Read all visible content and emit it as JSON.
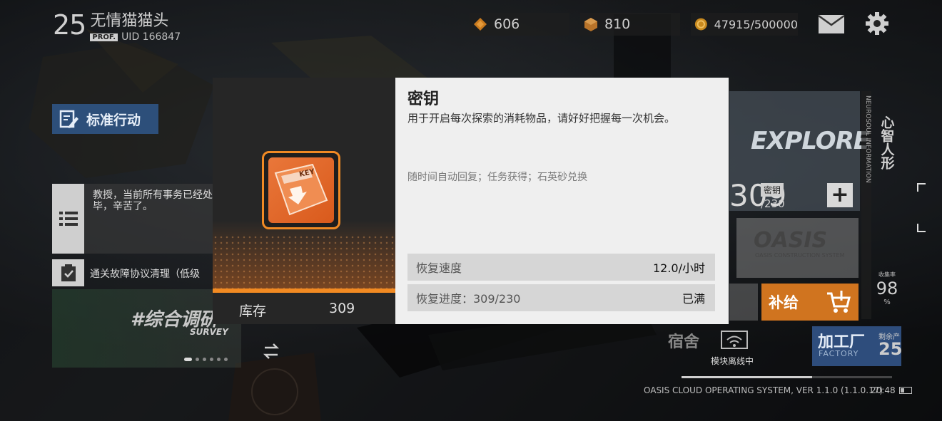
{
  "player": {
    "level": "25",
    "name": "无情猫猫头",
    "badge": "PROF.",
    "uid": "UID 166847"
  },
  "resources": [
    {
      "icon": "gem-icon",
      "value": "606"
    },
    {
      "icon": "crate-icon",
      "value": "810"
    },
    {
      "icon": "coin-icon",
      "value": "47915/500000"
    }
  ],
  "left": {
    "standard_action": "标准行动",
    "notice": "教授，当前所有事务已经处理完毕，辛苦了。",
    "task": "通关故障协议清理（低级",
    "survey_title": "#综合调研",
    "survey_sub": "SURVEY"
  },
  "right": {
    "explore": "EXPLORE",
    "key_big": "309",
    "key_tag": "密钥",
    "key_max": "/230",
    "plus": "+",
    "oasis": "OASIS",
    "oasis_sub": "OASIS CONSTRUCTION SYSTEM",
    "supply": "补给",
    "vertical_info": "NEUROSOUL INFORMATION",
    "mind": "心智人形",
    "rate_label": "收集率",
    "rate_value": "98",
    "rate_unit": "%",
    "dorm": "宿舍",
    "dorm_status": "模块离线中",
    "factory": "加工厂",
    "factory_en": "FACTORY",
    "factory_left_label": "剩余产",
    "factory_left_value": "25"
  },
  "system": {
    "line": "OASIS CLOUD OPERATING SYSTEM, VER 1.1.0 (1.1.0.17)",
    "time": "20:48"
  },
  "modal": {
    "item_name": "密钥",
    "description": "用于开启每次探索的消耗物品，请好好把握每一次机会。",
    "source": "随时间自动回复；任务获得；石英砂兑换",
    "stock_label": "库存",
    "stock_value": "309",
    "recovery_speed_label": "恢复速度",
    "recovery_speed_value": "12.0/小时",
    "recovery_progress_label": "恢复进度：309/230",
    "recovery_progress_value": "已满",
    "item_card_text": "KEY"
  },
  "colors": {
    "accent_orange": "#f28a22",
    "blue_button": "#2d4f7a",
    "modal_bg": "#efefef"
  }
}
